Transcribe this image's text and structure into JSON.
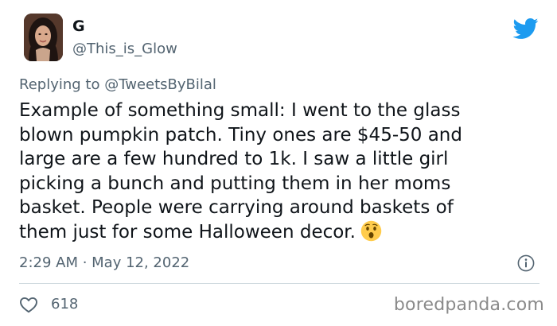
{
  "author": {
    "display_name": "G",
    "handle": "@This_is_Glow",
    "avatar": "profile-photo"
  },
  "platform_icon": "twitter-bird-icon",
  "reply": {
    "prefix": "Replying to",
    "mention": "@TweetsByBilal"
  },
  "tweet": {
    "lines": [
      "Example of something small: I went to the glass",
      "blown pumpkin patch. Tiny ones are $45-50 and",
      "large are a few hundred to 1k. I saw a little girl",
      "picking a bunch and putting them in her moms",
      "basket. People were carrying around baskets of",
      "them just for some Halloween decor."
    ],
    "emoji": "hushed-face-emoji"
  },
  "timestamp": "2:29 AM · May 12, 2022",
  "info_icon": "info-icon",
  "actions": {
    "like_icon": "heart-icon",
    "like_count": "618"
  },
  "watermark": "boredpanda.com",
  "colors": {
    "twitter_blue": "#1d9bf0",
    "text_primary": "#0f1419",
    "text_secondary": "#536471",
    "divider": "#cfd9de"
  }
}
